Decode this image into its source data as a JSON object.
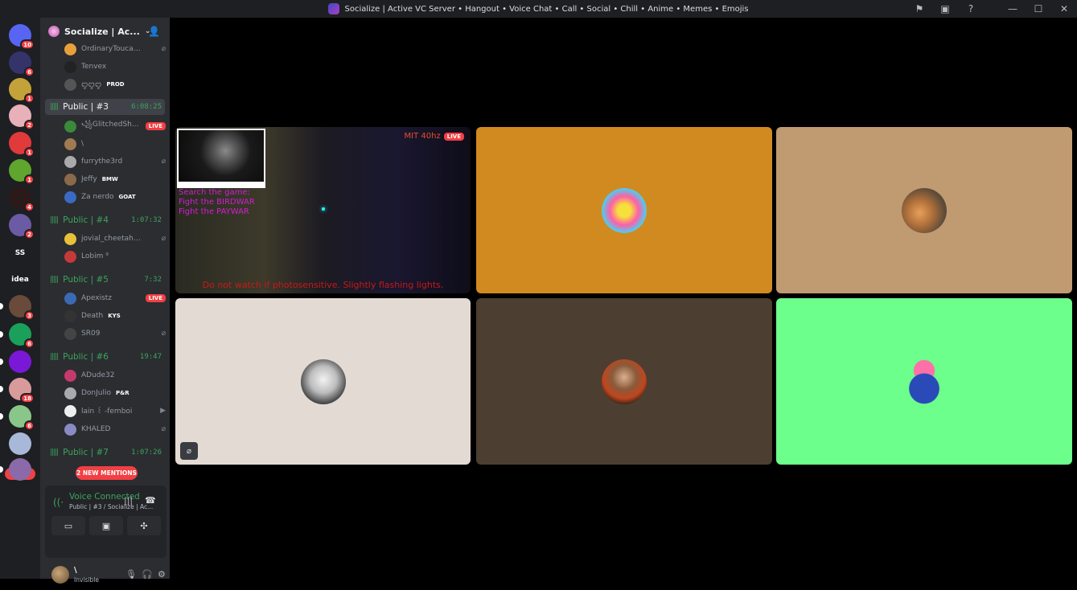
{
  "window": {
    "title": "Socialize | Active VC Server • Hangout • Voice Chat • Call • Social • Chill • Anime • Memes • Emojis",
    "controls": [
      "flag-icon",
      "inbox-icon",
      "help-icon",
      "minimize",
      "maximize",
      "close"
    ]
  },
  "guilds": [
    {
      "name": "direct-messages",
      "badge": "10",
      "color": "#5865f2",
      "label": ""
    },
    {
      "name": "guild-socialize",
      "badge": "6",
      "color": "#34346b",
      "label": ""
    },
    {
      "name": "guild-anime-1",
      "badge": "1",
      "color": "#c4a23a",
      "label": ""
    },
    {
      "name": "guild-anime-2",
      "badge": "2",
      "color": "#e8b0b8",
      "label": ""
    },
    {
      "name": "guild-red",
      "badge": "1",
      "color": "#e03a3a",
      "label": ""
    },
    {
      "name": "guild-frog",
      "badge": "1",
      "color": "#5fa52e",
      "label": ""
    },
    {
      "name": "guild-dark",
      "badge": "4",
      "color": "#2a1a1a",
      "label": ""
    },
    {
      "name": "guild-purple",
      "badge": "2",
      "color": "#6b5ba5",
      "label": ""
    },
    {
      "name": "guild-ss",
      "badge": "",
      "color": "#1e1f22",
      "label": "SS"
    },
    {
      "name": "guild-text-logo",
      "badge": "",
      "color": "#1e1f22",
      "label": "idea"
    },
    {
      "name": "guild-portrait",
      "badge": "3",
      "color": "#6a4a3a",
      "label": ""
    },
    {
      "name": "guild-green-p",
      "badge": "6",
      "color": "#1aa05a",
      "label": ""
    },
    {
      "name": "guild-violet",
      "badge": "",
      "color": "#7a18d8",
      "label": ""
    },
    {
      "name": "guild-pink",
      "badge": "18",
      "color": "#d89a9a",
      "label": ""
    },
    {
      "name": "guild-green-girl",
      "badge": "6",
      "color": "#8ac68a",
      "label": ""
    },
    {
      "name": "guild-cat",
      "badge": "",
      "color": "#a8b8d8",
      "label": ""
    },
    {
      "name": "guild-bottom",
      "badge": "",
      "color": "#8a6aa8",
      "label": ""
    }
  ],
  "new_badge": "NEW",
  "server": {
    "name": "Socialize | Ac...",
    "invite_icon": "add-member-icon"
  },
  "users_top": [
    {
      "name": "OrdinaryToucan3...",
      "tag": "",
      "color": "#e8a03a",
      "extra": "micoff"
    },
    {
      "name": "Tenvex",
      "tag": "",
      "color": "#222",
      "extra": ""
    },
    {
      "name": "ꨄꨄꨄ",
      "tag": "PROD",
      "color": "#555",
      "extra": ""
    }
  ],
  "channels": [
    {
      "name": "Public | #3",
      "timer": "6:08:25",
      "active": true,
      "users": [
        {
          "name": "꧁GlitchedSh...",
          "tag": "",
          "color": "#3a8a3a",
          "extra": "live"
        },
        {
          "name": "\\",
          "tag": "",
          "color": "#a07a50",
          "extra": ""
        },
        {
          "name": "furrythe3rd",
          "tag": "",
          "color": "#aaa",
          "extra": "micoff"
        },
        {
          "name": "Jeffy",
          "tag": "BMW",
          "color": "#8a6a4a",
          "extra": ""
        },
        {
          "name": "Za nerdo",
          "tag": "GOAT",
          "color": "#3a6ac4",
          "extra": ""
        }
      ]
    },
    {
      "name": "Public | #4",
      "timer": "1:07:32",
      "active": false,
      "users": [
        {
          "name": "jovial_cheetah_1...",
          "tag": "",
          "color": "#e8c03a",
          "extra": "micoff"
        },
        {
          "name": "Lobim ⁹",
          "tag": "",
          "color": "#c43a3a",
          "extra": ""
        }
      ]
    },
    {
      "name": "Public | #5",
      "timer": "7:32",
      "active": false,
      "users": [
        {
          "name": "Apexistz",
          "tag": "",
          "color": "#3a6ab4",
          "extra": "live"
        },
        {
          "name": "Death",
          "tag": "KYS",
          "color": "#333",
          "extra": ""
        },
        {
          "name": "SR09",
          "tag": "",
          "color": "#444",
          "extra": "micoff"
        }
      ]
    },
    {
      "name": "Public | #6",
      "timer": "19:47",
      "active": false,
      "users": [
        {
          "name": "ADude32",
          "tag": "",
          "color": "#c43a6a",
          "extra": ""
        },
        {
          "name": "DonJulio",
          "tag": "P&R",
          "color": "#aaa",
          "extra": ""
        },
        {
          "name": "lain ꒰ -femboi",
          "tag": "",
          "color": "#eee",
          "extra": "video"
        },
        {
          "name": "KHALED",
          "tag": "",
          "color": "#8a8ac4",
          "extra": "micoff"
        }
      ]
    },
    {
      "name": "Public | #7",
      "timer": "1:07:26",
      "active": false,
      "users": []
    }
  ],
  "mentions": "2 NEW MENTIONS",
  "voice": {
    "status": "Voice Connected",
    "location": "Public | #3 / Socialize | Ac..."
  },
  "me": {
    "name": "\\",
    "status": "Invisible"
  },
  "stream": {
    "label": "MIT 40hz",
    "live": "LIVE",
    "overlay_lines": [
      "Search the game:",
      "Fight the BIRDWAR",
      "Fight the PAYWAR"
    ],
    "caption": "Do not watch if photosensitive. Slightly flashing lights."
  },
  "tiles": [
    {
      "name": "tile-orange",
      "bg": "#d08a20"
    },
    {
      "name": "tile-tan",
      "bg": "#c09a70"
    },
    {
      "name": "tile-light",
      "bg": "#e2dad3"
    },
    {
      "name": "tile-brown",
      "bg": "#4c3e30"
    },
    {
      "name": "tile-green",
      "bg": "#6cff8c"
    }
  ],
  "badges": {
    "live": "LIVE"
  }
}
